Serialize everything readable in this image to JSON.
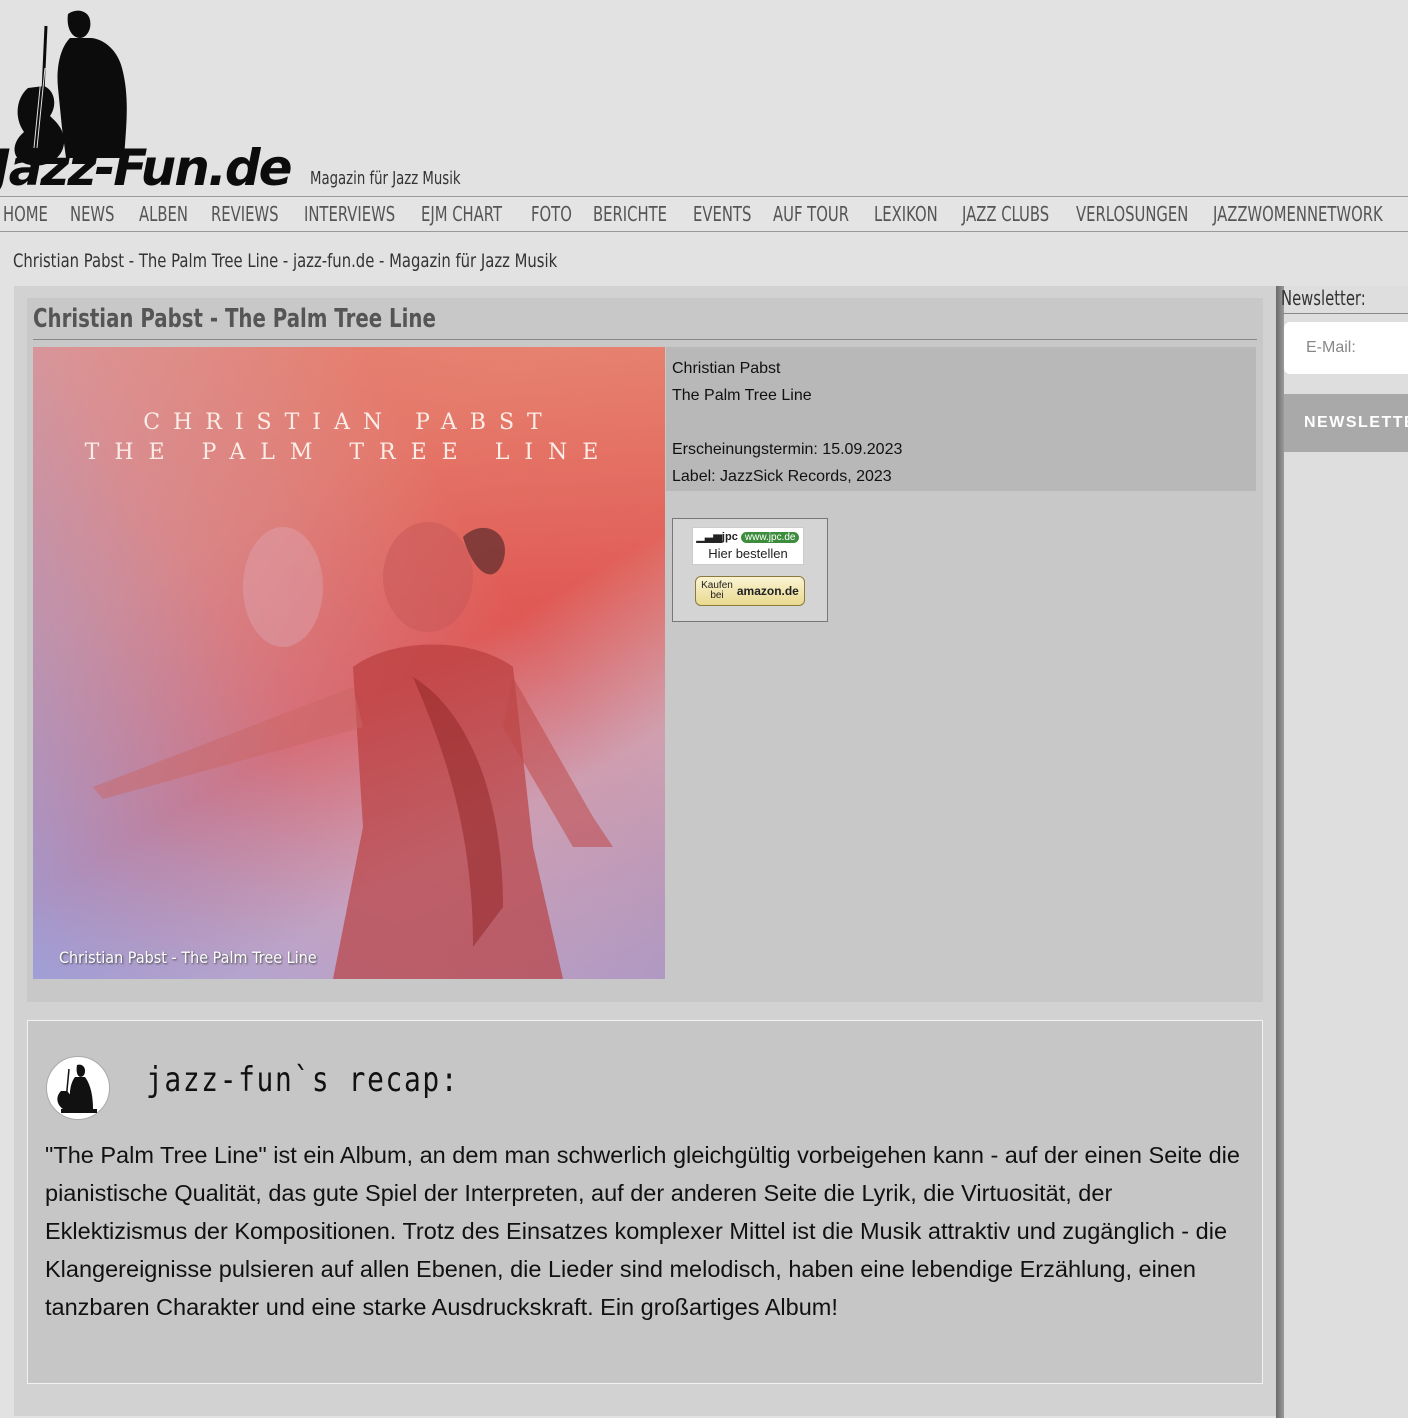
{
  "site": {
    "logo_text": "Jazz-Fun.de",
    "tagline": "Magazin für Jazz Musik"
  },
  "nav": {
    "items": [
      "HOME",
      "NEWS",
      "ALBEN",
      "REVIEWS",
      "INTERVIEWS",
      "EJM CHART",
      "FOTO",
      "BERICHTE",
      "EVENTS",
      "AUF TOUR",
      "LEXIKON",
      "JAZZ CLUBS",
      "VERLOSUNGEN",
      "JAZZWOMENNETWORK"
    ]
  },
  "breadcrumb": "Christian Pabst - The Palm Tree Line - jazz-fun.de - Magazin für Jazz Musik",
  "article": {
    "title": "Christian Pabst - The Palm Tree Line",
    "cover": {
      "line1": "CHRISTIAN PABST",
      "line2": "THE PALM TREE LINE",
      "caption": "Christian Pabst - The Palm Tree Line"
    },
    "info": {
      "artist": "Christian Pabst",
      "album": "The Palm Tree Line",
      "release": "Erscheinungstermin: 15.09.2023",
      "label": "Label: JazzSick Records, 2023"
    },
    "shop": {
      "jpc_logo": "jpc",
      "jpc_url_badge": "www.jpc.de",
      "jpc_label": "Hier bestellen",
      "amazon_prefix_1": "Kaufen",
      "amazon_prefix_2": "bei",
      "amazon_brand": "amazon.de"
    }
  },
  "recap": {
    "heading": "jazz-fun`s recap:",
    "text": "\"The Palm Tree Line\" ist ein Album, an dem man schwerlich gleichgültig vorbeigehen kann - auf der einen Seite die pianistische Qualität, das gute Spiel der Interpreten, auf der anderen Seite die Lyrik, die Virtuosität, der Eklektizismus der Kompositionen. Trotz des Einsatzes komplexer Mittel ist die Musik attraktiv und zugänglich - die Klangereignisse pulsieren auf allen Ebenen, die Lieder sind melodisch, haben eine lebendige Erzählung, einen tanzbaren Charakter und eine starke Ausdruckskraft. Ein großartiges Album!"
  },
  "sidebar": {
    "newsletter_label": "Newsletter:",
    "email_placeholder": "E-Mail:",
    "newsletter_button": "NEWSLETTER"
  },
  "colors": {
    "page_bg": "#e2e2e2",
    "panel_bg": "#c8c8c8",
    "info_bg": "#b8b8b8",
    "nav_text": "#555555"
  }
}
